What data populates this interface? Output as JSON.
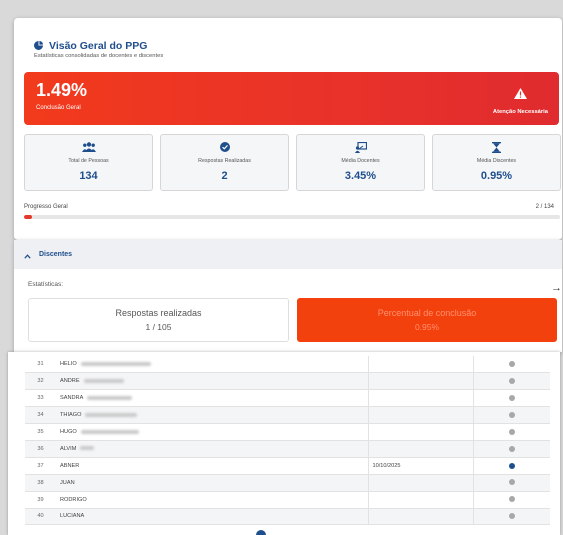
{
  "overview": {
    "title": "Visão Geral do PPG",
    "subtitle": "Estatísticas consolidadas de docentes e discentes"
  },
  "banner": {
    "percent": "1.49%",
    "label": "Conclusão Geral",
    "alert": "Atenção Necessária",
    "color": "#e8322a"
  },
  "stats": [
    {
      "icon": "users-icon",
      "label": "Total de Pessoas",
      "value": "134"
    },
    {
      "icon": "check-circle-icon",
      "label": "Respostas Realizadas",
      "value": "2"
    },
    {
      "icon": "teacher-board-icon",
      "label": "Média Docentes",
      "value": "3.45%"
    },
    {
      "icon": "hourglass-icon",
      "label": "Média Discentes",
      "value": "0.95%"
    }
  ],
  "progress": {
    "label": "Progresso Geral",
    "count": "2 / 134",
    "fraction": 0.0149
  },
  "discentes": {
    "title": "Discentes",
    "stats_label": "Estatísticas:",
    "responses_label": "Respostas realizadas",
    "responses_value": "1 / 105",
    "completion_label": "Percentual de conclusão",
    "completion_value": "0.95%"
  },
  "table": {
    "rows": [
      {
        "num": "31",
        "name": "HELIO",
        "date": "",
        "done": false
      },
      {
        "num": "32",
        "name": "ANDRE",
        "date": "",
        "done": false
      },
      {
        "num": "33",
        "name": "SANDRA",
        "date": "",
        "done": false
      },
      {
        "num": "34",
        "name": "THIAGO",
        "date": "",
        "done": false
      },
      {
        "num": "35",
        "name": "HUGO",
        "date": "",
        "done": false
      },
      {
        "num": "36",
        "name": "ALVIM",
        "date": "",
        "done": false
      },
      {
        "num": "37",
        "name": "ABNER",
        "date": "10/10/2025",
        "done": true
      },
      {
        "num": "38",
        "name": "JUAN",
        "date": "",
        "done": false
      },
      {
        "num": "39",
        "name": "RODRIGO",
        "date": "",
        "done": false
      },
      {
        "num": "40",
        "name": "LUCIANA",
        "date": "",
        "done": false
      }
    ]
  }
}
